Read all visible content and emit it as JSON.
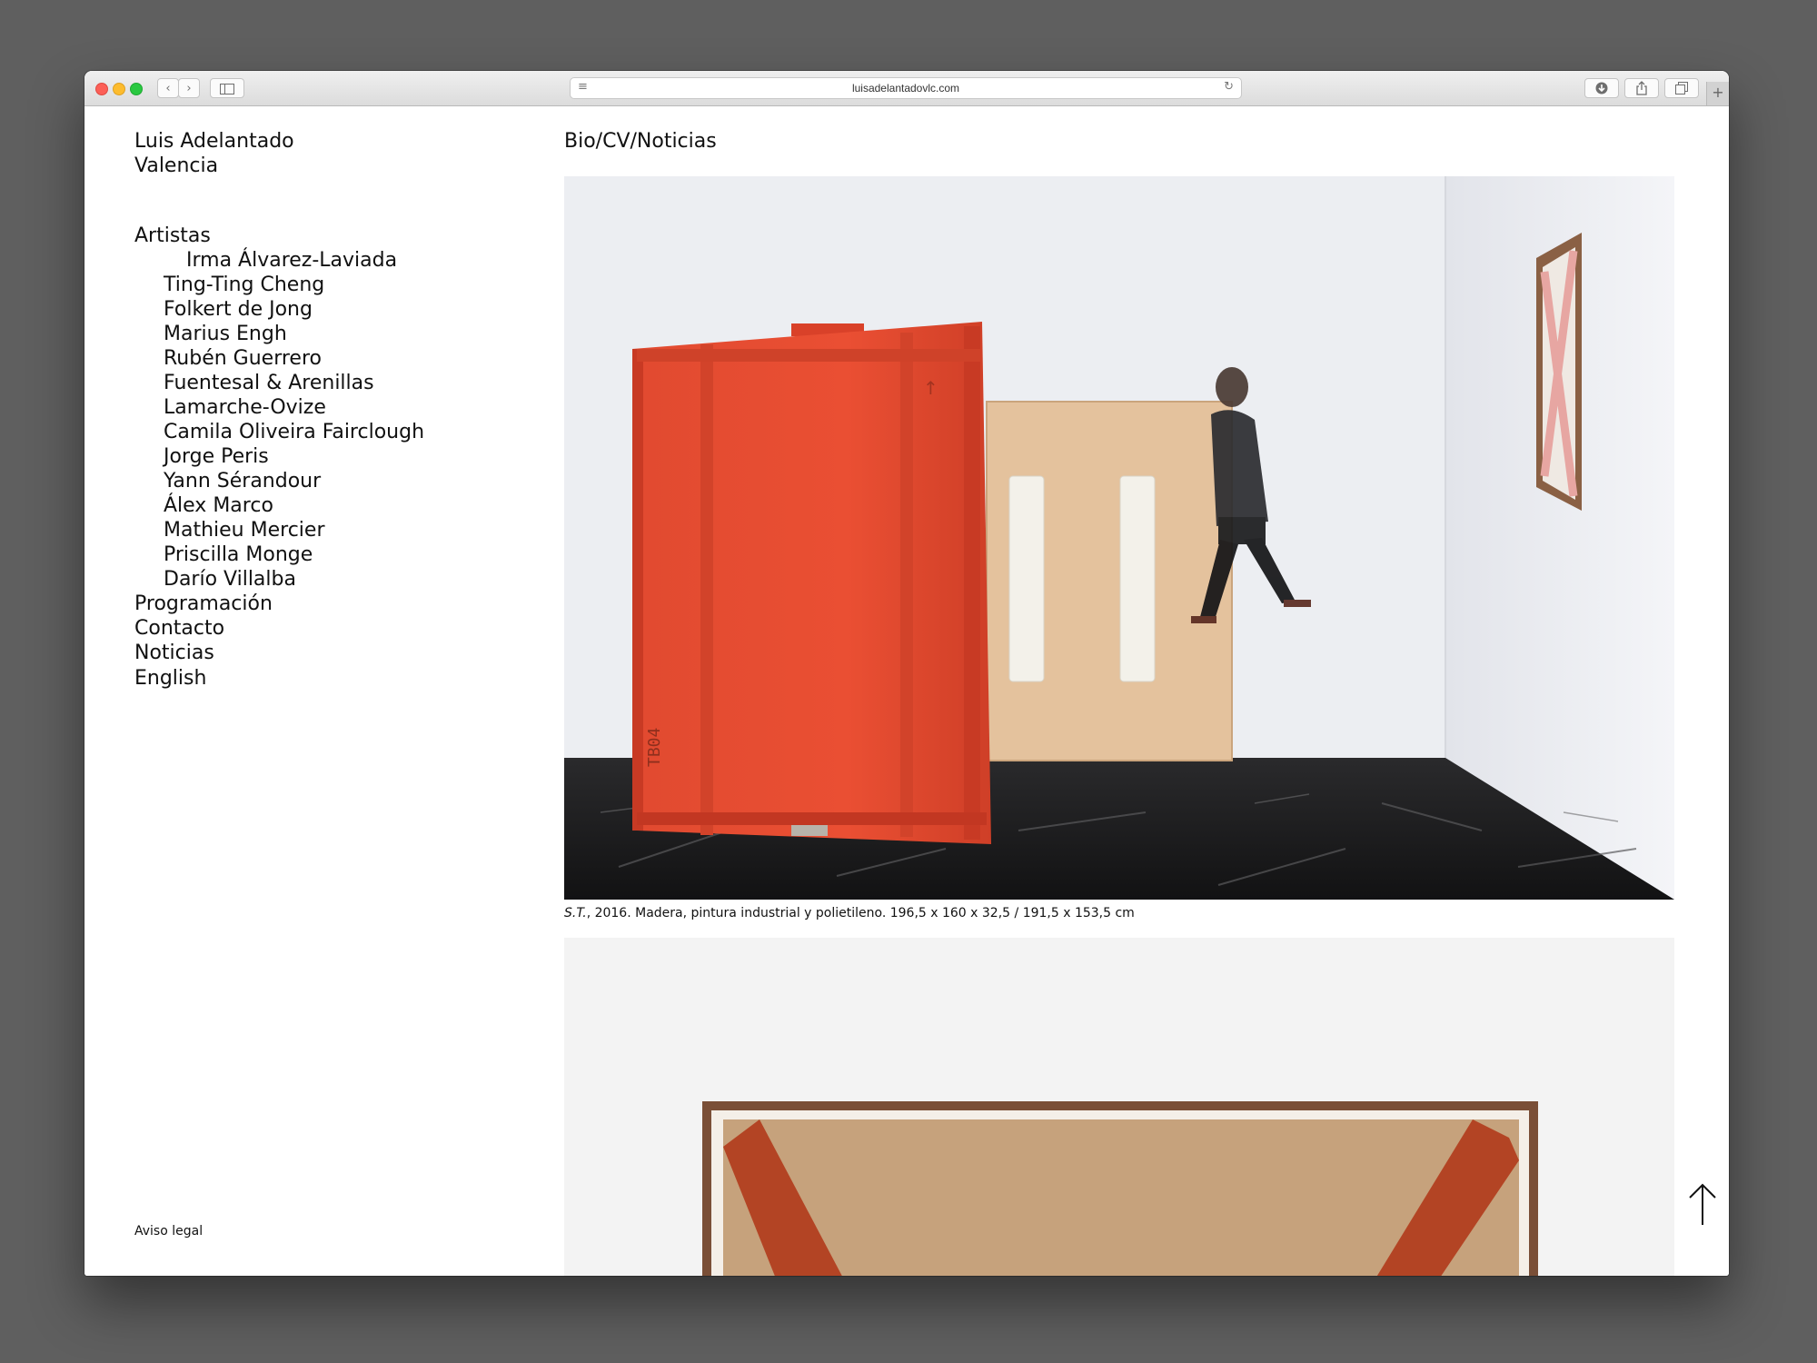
{
  "browser": {
    "url": "luisadelantadovlc.com",
    "back_icon": "‹",
    "forward_icon": "›",
    "new_tab_icon": "+"
  },
  "site": {
    "name": "Luis Adelantado",
    "city": "Valencia"
  },
  "nav": {
    "artists_label": "Artistas",
    "artists": [
      "Irma Álvarez-Laviada",
      "Ting-Ting Cheng",
      "Folkert de Jong",
      "Marius Engh",
      "Rubén Guerrero",
      "Fuentesal & Arenillas",
      "Lamarche-Ovize",
      "Camila Oliveira Fairclough",
      "Jorge Peris",
      "Yann Sérandour",
      "Álex Marco",
      "Mathieu Mercier",
      "Priscilla Monge",
      "Darío Villalba"
    ],
    "programacion": "Programación",
    "contacto": "Contacto",
    "noticias": "Noticias",
    "language": "English",
    "legal": "Aviso legal"
  },
  "main": {
    "subnav": "Bio/CV/Noticias",
    "artwork1": {
      "caption_title": "S.T.",
      "caption_rest": ", 2016. Madera, pintura industrial y polietileno. 196,5 x 160 x 32,5 / 191,5 x 153,5 cm",
      "crate_label": "TB04"
    }
  },
  "colors": {
    "crate_orange": "#e6452d",
    "plywood": "#e4c29d",
    "wall": "#eceef2",
    "floor": "#1c1c1d",
    "frame_wood": "#8a6044",
    "cross_pink": "#e7a6a2",
    "cross_rust": "#b34424"
  }
}
